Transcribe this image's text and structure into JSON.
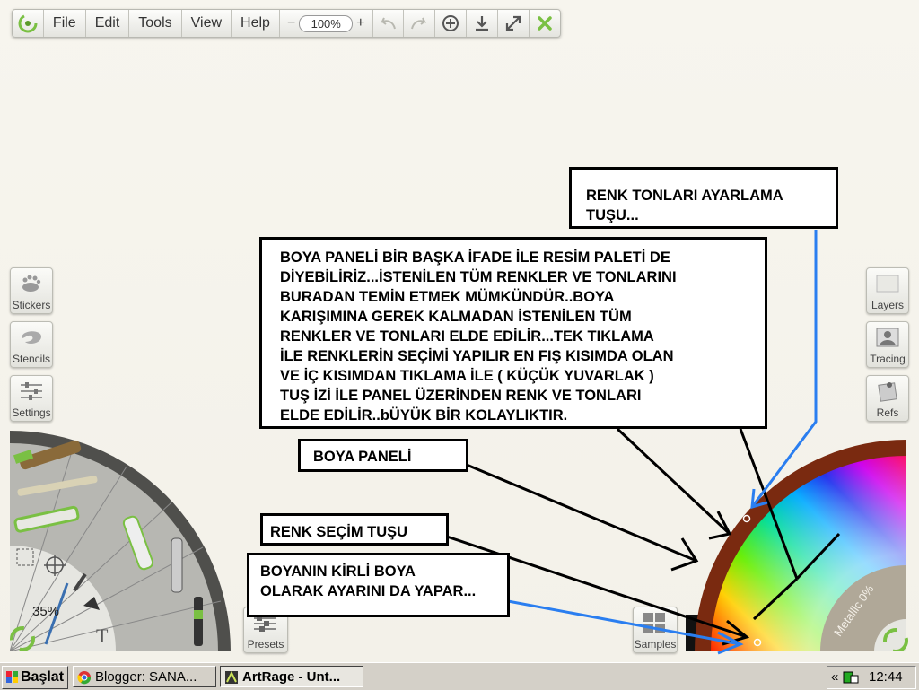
{
  "toolbar": {
    "menu": [
      "File",
      "Edit",
      "Tools",
      "View",
      "Help"
    ],
    "zoom": "100%",
    "zoom_minus": "−",
    "zoom_plus": "+"
  },
  "left_buttons": [
    "Stickers",
    "Stencils",
    "Settings"
  ],
  "right_buttons": [
    "Layers",
    "Tracing",
    "Refs"
  ],
  "tool_panel": {
    "size_readout": "35%"
  },
  "bottom_buttons": {
    "presets": "Presets",
    "samples": "Samples"
  },
  "color_panel": {
    "metallic": "Metallic 0%"
  },
  "notes": {
    "renk_tonlari": [
      "RENK TONLARI AYARLAMA",
      "TUŞU..."
    ],
    "boya_paneli_desc": [
      "BOYA PANELİ BİR BAŞKA İFADE İLE RESİM PALETİ DE",
      "DİYEBİLİRİZ...İSTENİLEN TÜM RENKLER VE TONLARINI",
      "BURADAN TEMİN ETMEK MÜMKÜNDÜR..BOYA",
      "KARIŞIMINA GEREK KALMADAN İSTENİLEN TÜM",
      "RENKLER VE TONLARI ELDE EDİLİR...TEK TIKLAMA",
      "İLE RENKLERİN SEÇİMİ YAPILIR EN FIŞ KISIMDA OLAN",
      "VE İÇ KISIMDAN TIKLAMA İLE ( KÜÇÜK YUVARLAK )",
      "TUŞ İZİ İLE PANEL ÜZERİNDEN RENK VE TONLARI",
      "ELDE EDİLİR..bÜYÜK BİR KOLAYLIKTIR."
    ],
    "boya_paneli": "BOYA PANELİ",
    "renk_secim": "RENK SEÇİM TUŞU",
    "kirli_boya": [
      "BOYANIN KİRLİ BOYA",
      "OLARAK AYARINI DA YAPAR..."
    ]
  },
  "taskbar": {
    "start": "Başlat",
    "tasks": [
      "Blogger: SANA...",
      "ArtRage - Unt..."
    ],
    "tray_arrow": "«",
    "clock": "12:44"
  },
  "colors": {
    "accent_green": "#7ac043",
    "arrow_blue": "#2a7ef0",
    "wheel_brown": "#7a2a10"
  }
}
